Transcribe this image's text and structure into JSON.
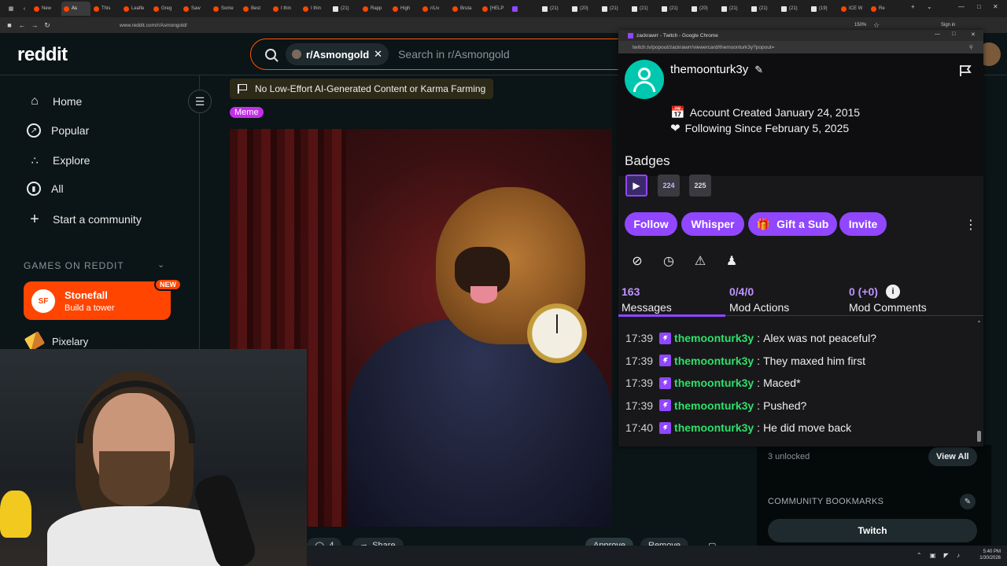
{
  "browser": {
    "tabs": [
      "New",
      "As",
      "This",
      "Leafle",
      "Greg",
      "Saw",
      "Some",
      "Best",
      "I thin",
      "I thin",
      "(21)",
      "Rapp",
      "High",
      "r/Liv",
      "Bruta",
      "[HELP",
      "",
      "(21)",
      "(20)",
      "(21)",
      "(21)",
      "(21)",
      "(20)",
      "(21)",
      "(21)",
      "(21)",
      "(19)",
      "ICE W",
      "Re"
    ],
    "url": "www.reddit.com/r/Asmongold/",
    "signin": "Sign in",
    "zoom": "150%"
  },
  "reddit": {
    "logo": "reddit",
    "search_chip": "r/Asmongold",
    "search_placeholder": "Search in r/Asmongold",
    "nav": {
      "home": "Home",
      "popular": "Popular",
      "explore": "Explore",
      "all": "All",
      "start_community": "Start a community"
    },
    "games_section": "GAMES ON REDDIT",
    "stonefall": {
      "title": "Stonefall",
      "subtitle": "Build a tower",
      "badge": "NEW",
      "logo": "SF"
    },
    "pixelary": "Pixelary",
    "rule_banner": "No Low-Effort AI-Generated Content or Karma Farming",
    "flair": "Meme",
    "post_actions": {
      "comments": "4",
      "share": "Share",
      "approve": "Approve",
      "remove": "Remove"
    },
    "right_rail": {
      "unlocked": "3 unlocked",
      "view_all": "View All",
      "bookmarks_title": "COMMUNITY BOOKMARKS",
      "bookmark_twitch": "Twitch"
    }
  },
  "popout": {
    "window_title": "zackrawrr - Twitch - Google Chrome",
    "url": "twitch.tv/popout/zackrawrr/viewercard/themoonturk3y?popout=",
    "username": "themoonturk3y",
    "account_created": "Account Created January 24, 2015",
    "following_since": "Following Since February 5, 2025",
    "badges_title": "Badges",
    "badges": [
      "prime",
      "24",
      "25"
    ],
    "actions": {
      "follow": "Follow",
      "whisper": "Whisper",
      "gift": "Gift a Sub",
      "invite": "Invite"
    },
    "stats": [
      {
        "value": "163",
        "label": "Messages"
      },
      {
        "value": "0/4/0",
        "label": "Mod Actions"
      },
      {
        "value": "0 (+0)",
        "label": "Mod Comments"
      }
    ],
    "messages": [
      {
        "time": "17:39",
        "user": "themoonturk3y",
        "text": "Alex was not peaceful?"
      },
      {
        "time": "17:39",
        "user": "themoonturk3y",
        "text": "They maxed him first"
      },
      {
        "time": "17:39",
        "user": "themoonturk3y",
        "text": "Maced*"
      },
      {
        "time": "17:39",
        "user": "themoonturk3y",
        "text": "Pushed?"
      },
      {
        "time": "17:40",
        "user": "themoonturk3y",
        "text": "He did move back"
      }
    ],
    "colors": {
      "accent": "#9146ff",
      "username": "#2ee06a",
      "avatar": "#00c8af"
    }
  },
  "taskbar": {
    "time": "5:40 PM",
    "date": "1/30/2026"
  }
}
